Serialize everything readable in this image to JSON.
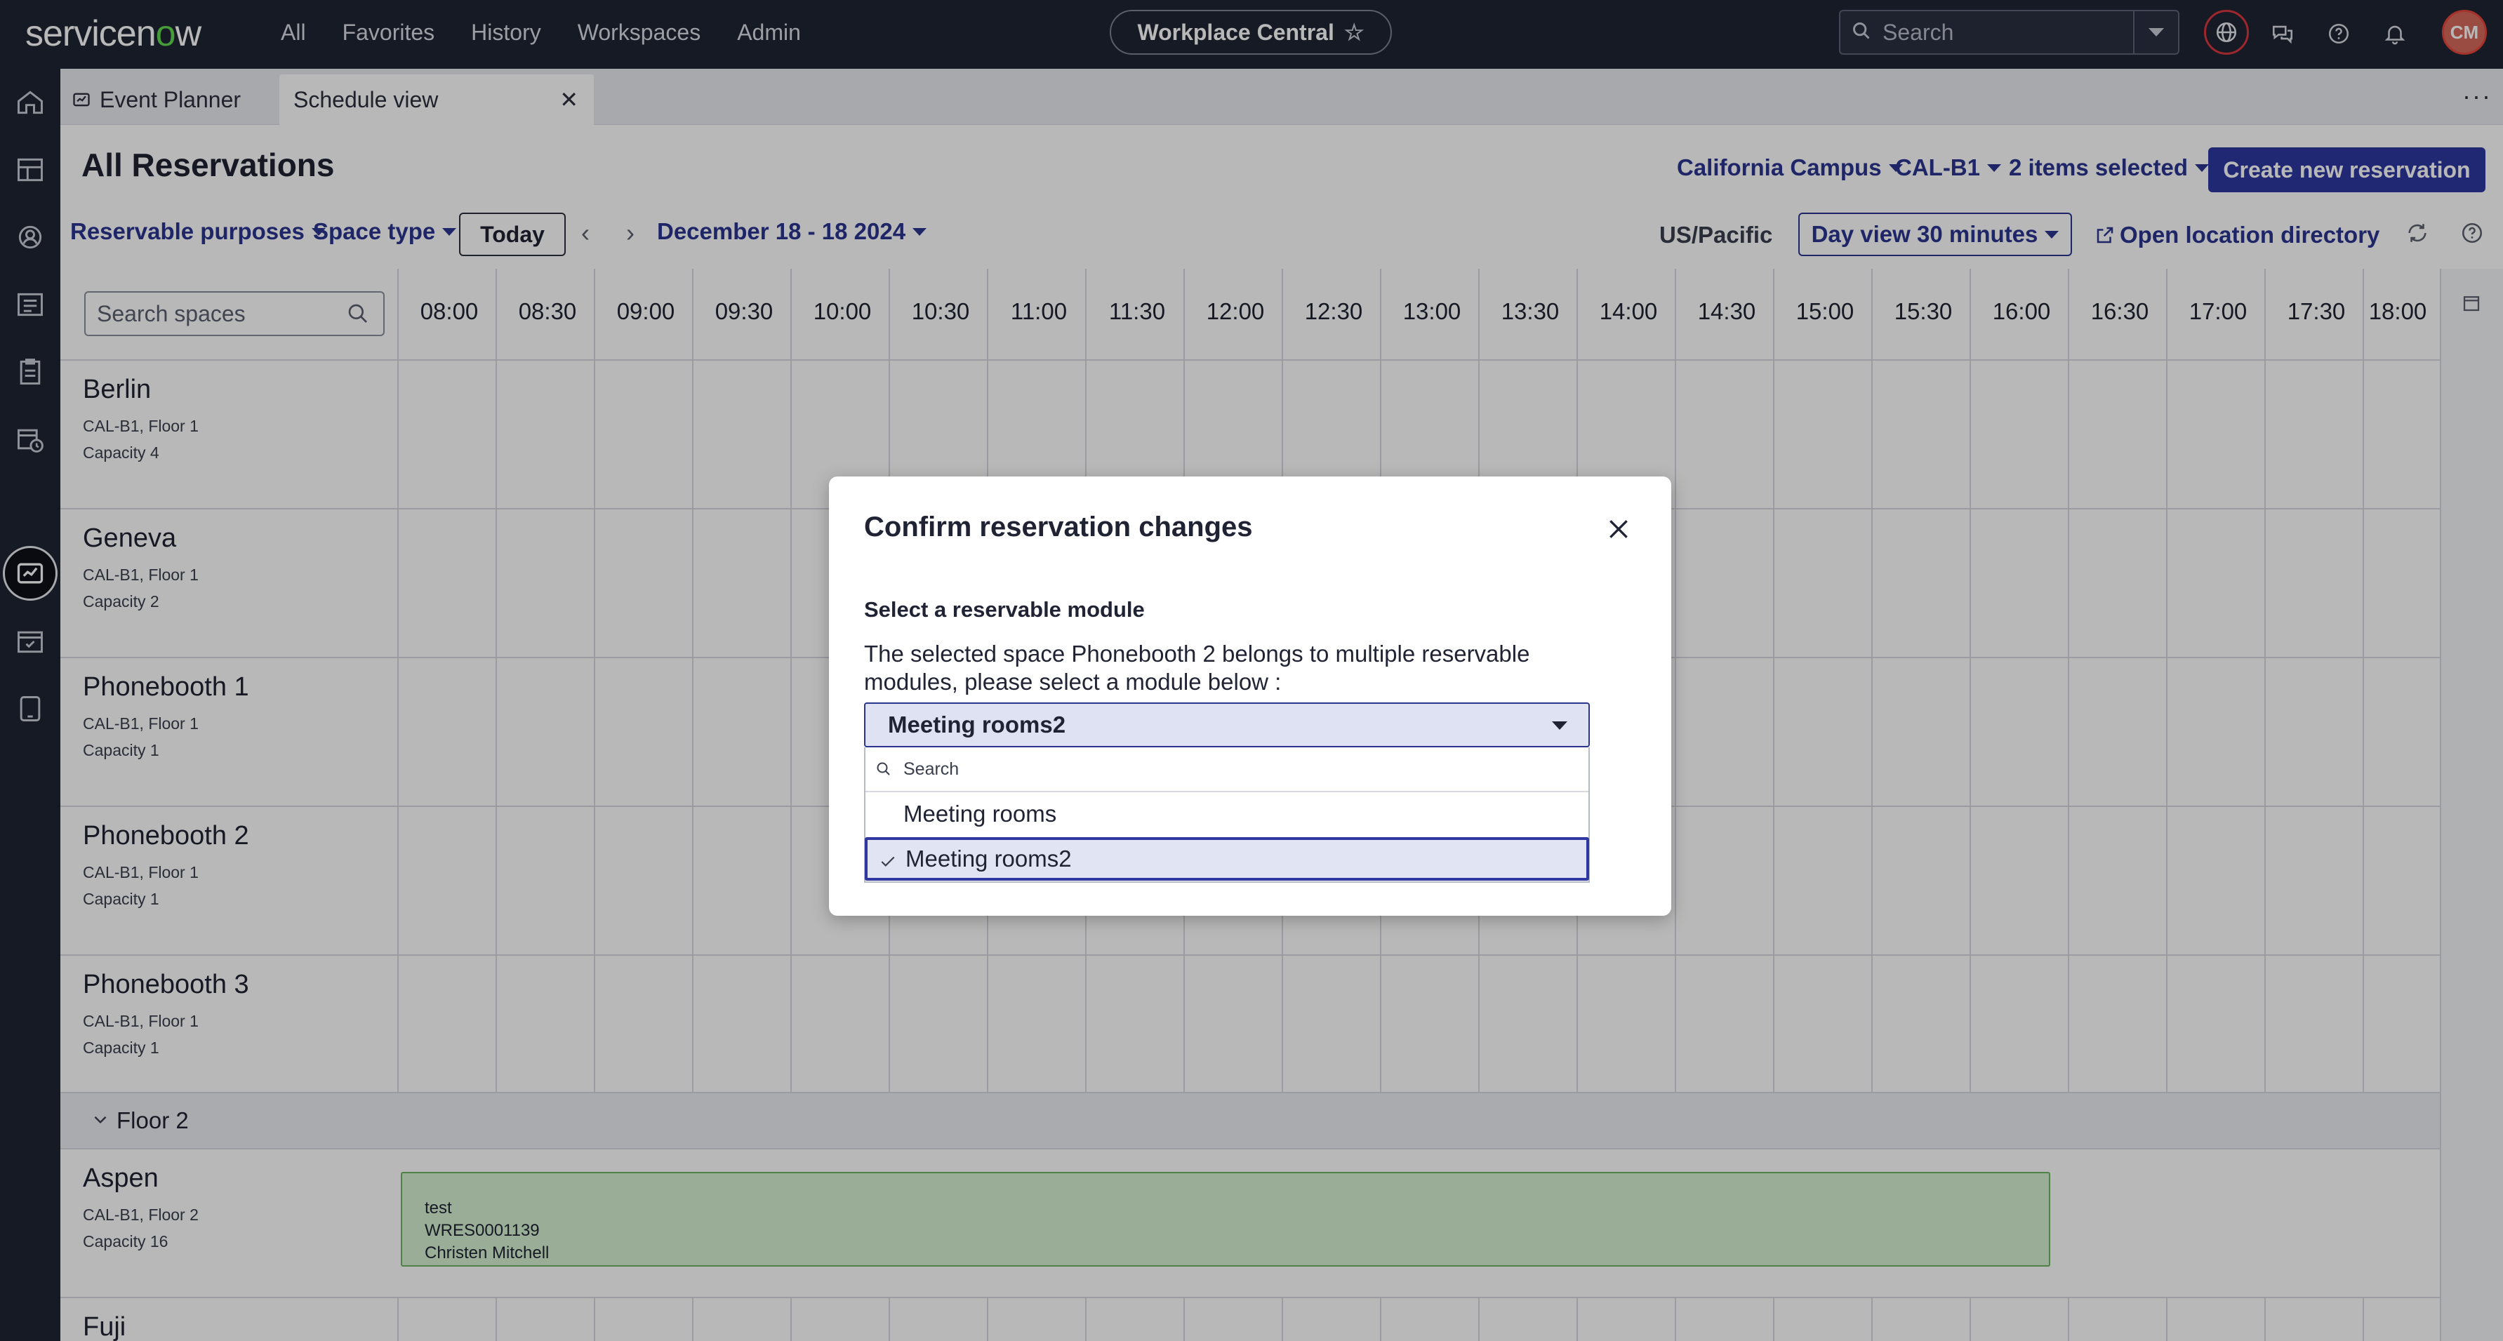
{
  "topnav": {
    "logo_text_a": "servicen",
    "logo_text_o": "o",
    "logo_text_b": "w",
    "links": [
      "All",
      "Favorites",
      "History",
      "Workspaces",
      "Admin"
    ],
    "workspace_name": "Workplace Central",
    "search_placeholder": "Search",
    "avatar_initials": "CM"
  },
  "tabs": {
    "items": [
      {
        "label": "Event Planner"
      },
      {
        "label": "Schedule view"
      }
    ],
    "more": "···"
  },
  "header": {
    "title": "All Reservations",
    "campus": "California Campus",
    "building": "CAL-B1",
    "items_selected": "2 items selected",
    "create_button": "Create new reservation",
    "filter_purposes": "Reservable purposes",
    "filter_space_type": "Space type",
    "today_button": "Today",
    "date_range": "December 18 - 18 2024",
    "timezone": "US/Pacific",
    "day_view": "Day view 30 minutes",
    "open_directory": "Open location directory"
  },
  "grid": {
    "search_placeholder": "Search spaces",
    "times": [
      "08:00",
      "08:30",
      "09:00",
      "09:30",
      "10:00",
      "10:30",
      "11:00",
      "11:30",
      "12:00",
      "12:30",
      "13:00",
      "13:30",
      "14:00",
      "14:30",
      "15:00",
      "15:30",
      "16:00",
      "16:30",
      "17:00",
      "17:30",
      "18:00"
    ],
    "rows": [
      {
        "name": "Berlin",
        "location": "CAL-B1, Floor 1",
        "capacity": "Capacity 4"
      },
      {
        "name": "Geneva",
        "location": "CAL-B1, Floor 1",
        "capacity": "Capacity 2"
      },
      {
        "name": "Phonebooth 1",
        "location": "CAL-B1, Floor 1",
        "capacity": "Capacity 1"
      },
      {
        "name": "Phonebooth 2",
        "location": "CAL-B1, Floor 1",
        "capacity": "Capacity 1"
      },
      {
        "name": "Phonebooth 3",
        "location": "CAL-B1, Floor 1",
        "capacity": "Capacity 1"
      },
      {
        "name": "Aspen",
        "location": "CAL-B1, Floor 2",
        "capacity": "Capacity 16"
      },
      {
        "name": "Fuji",
        "location": "",
        "capacity": ""
      }
    ],
    "floor_group": "Floor 2",
    "event": {
      "title": "test",
      "number": "WRES0001139",
      "person": "Christen Mitchell"
    }
  },
  "modal": {
    "title": "Confirm reservation changes",
    "subtitle": "Select a reservable module",
    "description": "The selected space Phonebooth 2 belongs to multiple reservable modules, please select a module below :",
    "selected_value": "Meeting rooms2",
    "dropdown_search_placeholder": "Search",
    "options": [
      "Meeting rooms",
      "Meeting rooms2"
    ]
  },
  "colors": {
    "nav_bg": "#1f2433",
    "accent": "#2e38a0",
    "event_bg": "#d5f0d1",
    "logo_green": "#62d84e"
  }
}
